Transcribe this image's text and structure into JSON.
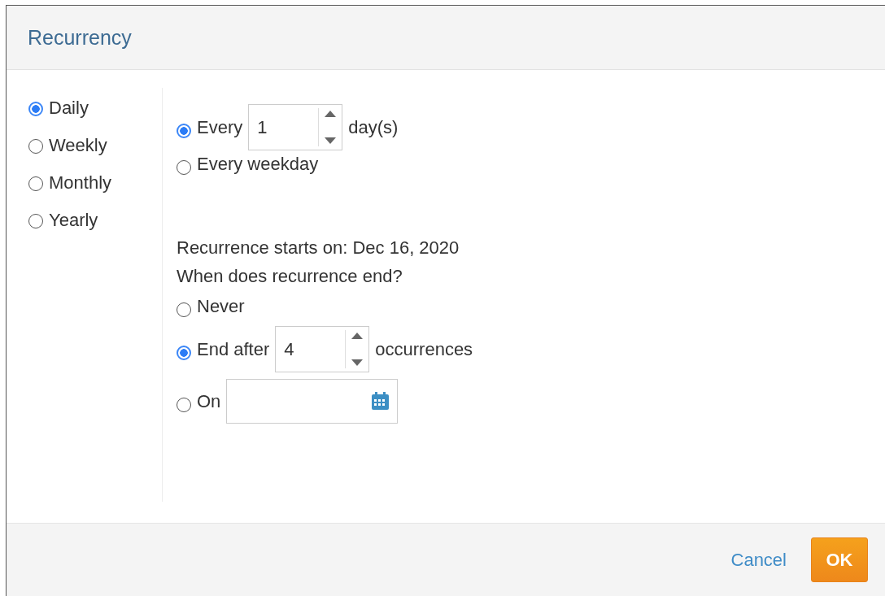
{
  "dialog": {
    "title": "Recurrency"
  },
  "patterns": [
    {
      "label": "Daily",
      "selected": true
    },
    {
      "label": "Weekly",
      "selected": false
    },
    {
      "label": "Monthly",
      "selected": false
    },
    {
      "label": "Yearly",
      "selected": false
    }
  ],
  "daily_options": [
    {
      "kind": "interval",
      "label": "Every",
      "value": "1",
      "suffix": "day(s)",
      "selected": true
    },
    {
      "kind": "plain",
      "label": "Every weekday",
      "selected": false
    }
  ],
  "start_text": "Recurrence starts on: Dec 16, 2020",
  "end_question": "When does recurrence end?",
  "end_options": [
    {
      "kind": "plain",
      "label": "Never",
      "selected": false
    },
    {
      "kind": "count",
      "label": "End after",
      "value": "4",
      "suffix": "occurrences",
      "selected": true
    },
    {
      "kind": "date",
      "label": "On",
      "selected": false
    }
  ],
  "buttons": [
    {
      "kind": "link",
      "label": "Cancel"
    },
    {
      "kind": "primary",
      "label": "OK"
    }
  ]
}
